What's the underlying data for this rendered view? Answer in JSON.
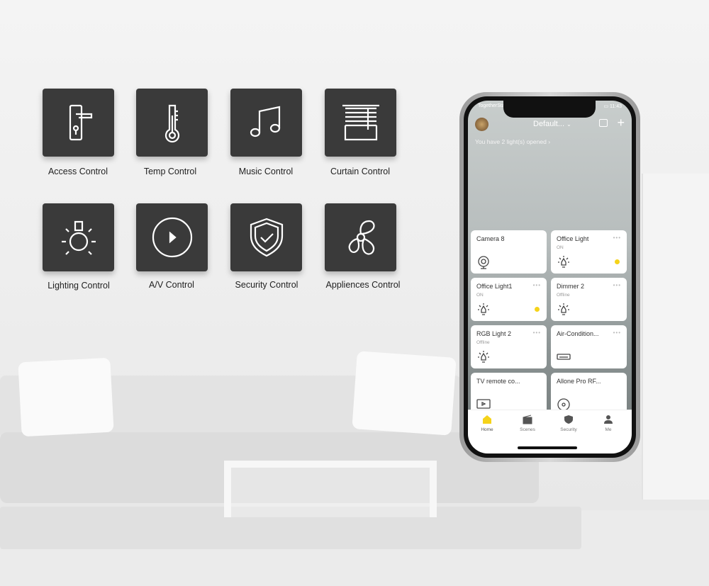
{
  "features": [
    {
      "label": "Access Control",
      "icon": "door-handle-icon"
    },
    {
      "label": "Temp Control",
      "icon": "thermometer-icon"
    },
    {
      "label": "Music Control",
      "icon": "music-note-icon"
    },
    {
      "label": "Curtain Control",
      "icon": "curtain-icon"
    },
    {
      "label": "Lighting Control",
      "icon": "light-bulb-icon"
    },
    {
      "label": "A/V Control",
      "icon": "play-icon"
    },
    {
      "label": "Security Control",
      "icon": "shield-check-icon"
    },
    {
      "label": "Appliences Control",
      "icon": "fan-icon"
    }
  ],
  "phone": {
    "status": {
      "carrier": "TogetherStar",
      "time": "11:43"
    },
    "header": {
      "home_name": "Default...",
      "notice": "You have 2 light(s) opened"
    },
    "accent": "#f5d31a",
    "devices": [
      {
        "name": "Camera 8",
        "status": "",
        "icon": "camera-icon",
        "menu": false,
        "on": false
      },
      {
        "name": "Office Light",
        "status": "ON",
        "icon": "bulb-icon",
        "menu": true,
        "on": true
      },
      {
        "name": "Office Light1",
        "status": "ON",
        "icon": "bulb-icon",
        "menu": true,
        "on": true
      },
      {
        "name": "Dimmer 2",
        "status": "Offline",
        "icon": "bulb-icon",
        "menu": true,
        "on": false
      },
      {
        "name": "RGB Light 2",
        "status": "Offline",
        "icon": "bulb-icon",
        "menu": true,
        "on": false
      },
      {
        "name": "Air-Condition...",
        "status": "",
        "icon": "air-conditioner-icon",
        "menu": true,
        "on": false
      },
      {
        "name": "TV remote co...",
        "status": "",
        "icon": "tv-icon",
        "menu": false,
        "on": false
      },
      {
        "name": "Allone Pro RF...",
        "status": "",
        "icon": "disc-icon",
        "menu": false,
        "on": false
      }
    ],
    "tabs": [
      {
        "label": "Home",
        "icon": "home-icon",
        "active": true
      },
      {
        "label": "Scenes",
        "icon": "clapperboard-icon",
        "active": false
      },
      {
        "label": "Security",
        "icon": "shield-icon",
        "active": false
      },
      {
        "label": "Me",
        "icon": "person-icon",
        "active": false
      }
    ]
  }
}
